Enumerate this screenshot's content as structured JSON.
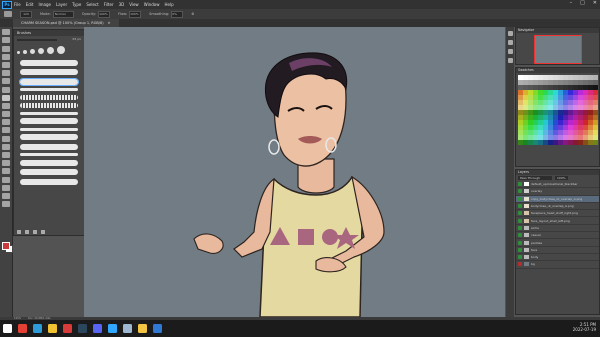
{
  "menubar": {
    "app_badge": "Ps",
    "items": [
      "File",
      "Edit",
      "Image",
      "Layer",
      "Type",
      "Select",
      "Filter",
      "3D",
      "View",
      "Window",
      "Help"
    ]
  },
  "options": {
    "size": "120",
    "mode_label": "Mode:",
    "mode_value": "Normal",
    "opacity_label": "Opacity:",
    "opacity_value": "100%",
    "flow_label": "Flow:",
    "flow_value": "100%",
    "smoothing_label": "Smoothing:",
    "smoothing_value": "0%"
  },
  "document": {
    "tab_title": "CHARM SEASON.psd @ 100% (Group 1, RGB/8)",
    "zoom": "100%",
    "size_info": "Doc: 26.8M/1.24G"
  },
  "brush_panel": {
    "title": "Brushes",
    "size_value": "65 px"
  },
  "right_panels": {
    "navigator_title": "Navigator",
    "swatches_title": "Swatches",
    "layers_title": "Layers",
    "blend_mode": "Pass Through",
    "opacity": "100%"
  },
  "layers": [
    {
      "name": "default_upclosetransl_blackbar",
      "visible": true,
      "selected": false,
      "thumb": "#ffffff"
    },
    {
      "name": "overlay",
      "visible": true,
      "selected": false,
      "thumb": "#cfcfcf"
    },
    {
      "name": "copy_bodyclose_ut_overlap_A.png",
      "visible": true,
      "selected": true,
      "thumb": "#e8e0cc"
    },
    {
      "name": "bodyclose_ut_overlap_A.png",
      "visible": true,
      "selected": false,
      "thumb": "#e8e0cc"
    },
    {
      "name": "faceplace_head_stuff_right.png",
      "visible": true,
      "selected": false,
      "thumb": "#d9c6a8"
    },
    {
      "name": "face_layout_shell_left.png",
      "visible": true,
      "selected": false,
      "thumb": "#d9c6a8"
    },
    {
      "name": "extra",
      "visible": true,
      "selected": false,
      "thumb": "#bbbbbb"
    },
    {
      "name": "casual",
      "visible": true,
      "selected": false,
      "thumb": "#bbbbbb"
    },
    {
      "name": "panties",
      "visible": true,
      "selected": false,
      "thumb": "#bbbbbb"
    },
    {
      "name": "face",
      "visible": true,
      "selected": false,
      "thumb": "#bbbbbb"
    },
    {
      "name": "body",
      "visible": true,
      "selected": false,
      "thumb": "#bbbbbb"
    },
    {
      "name": "bg",
      "visible": false,
      "selected": false,
      "thumb": "#717c84"
    }
  ],
  "taskbar": {
    "time": "2:51 PM",
    "date": "2022-07-19",
    "apps": [
      {
        "name": "start",
        "color": "#ffffff"
      },
      {
        "name": "chrome",
        "color": "#e44134"
      },
      {
        "name": "edge",
        "color": "#2d9bd8"
      },
      {
        "name": "file-explorer",
        "color": "#f1c232"
      },
      {
        "name": "media-player",
        "color": "#d93b3b"
      },
      {
        "name": "steam",
        "color": "#2a475e"
      },
      {
        "name": "discord",
        "color": "#5865f2"
      },
      {
        "name": "photoshop",
        "color": "#31a8ff"
      },
      {
        "name": "notepad",
        "color": "#9fb7d1"
      },
      {
        "name": "folder",
        "color": "#f4c542"
      },
      {
        "name": "mail",
        "color": "#2f78d4"
      }
    ]
  },
  "colors": {
    "foreground": "#cc3b3b",
    "background": "#ffffff",
    "canvas": "#717c84",
    "accent": "#31a8ff"
  }
}
